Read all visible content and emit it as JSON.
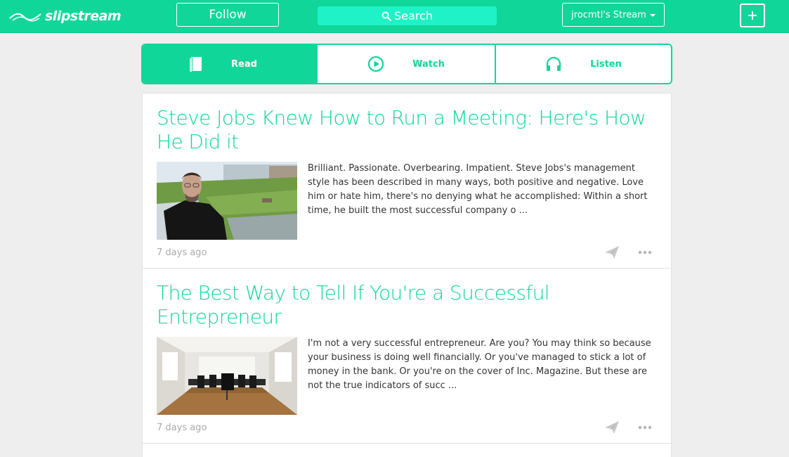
{
  "header": {
    "logo_text": "slipstream",
    "follow_label": "Follow",
    "search_label": "Search",
    "stream_label": "jrocmtl's Stream",
    "add_label": "+"
  },
  "tabs": [
    {
      "label": "Read",
      "icon": "book-icon",
      "active": true
    },
    {
      "label": "Watch",
      "icon": "play-circle-icon",
      "active": false
    },
    {
      "label": "Listen",
      "icon": "headphones-icon",
      "active": false
    }
  ],
  "articles": [
    {
      "title": "Steve Jobs Knew How to Run a Meeting: Here's How He Did it",
      "excerpt": "Brilliant. Passionate. Overbearing. Impatient. Steve Jobs's management style has been described in many ways, both positive and negative. Love him or hate him, there's no denying what he accomplished: Within a short time, he built the most successful company o ...",
      "timestamp": "7 days ago",
      "thumbnail": "portrait-outdoor-photo"
    },
    {
      "title": "The Best Way to Tell If You're a Successful Entrepreneur",
      "excerpt": "I'm not a very successful entrepreneur.  Are you? You may think so because your business is doing well financially.  Or you've managed to stick a lot of money in the bank.  Or you're on the cover of Inc. Magazine.  But these are not the true indicators of succ ...",
      "timestamp": "7 days ago",
      "thumbnail": "conference-room-photo"
    }
  ],
  "colors": {
    "brand": "#10d699",
    "search_bg": "#1ff2c6",
    "page_bg": "#eeeeee",
    "muted_text": "#aaaaaa"
  }
}
